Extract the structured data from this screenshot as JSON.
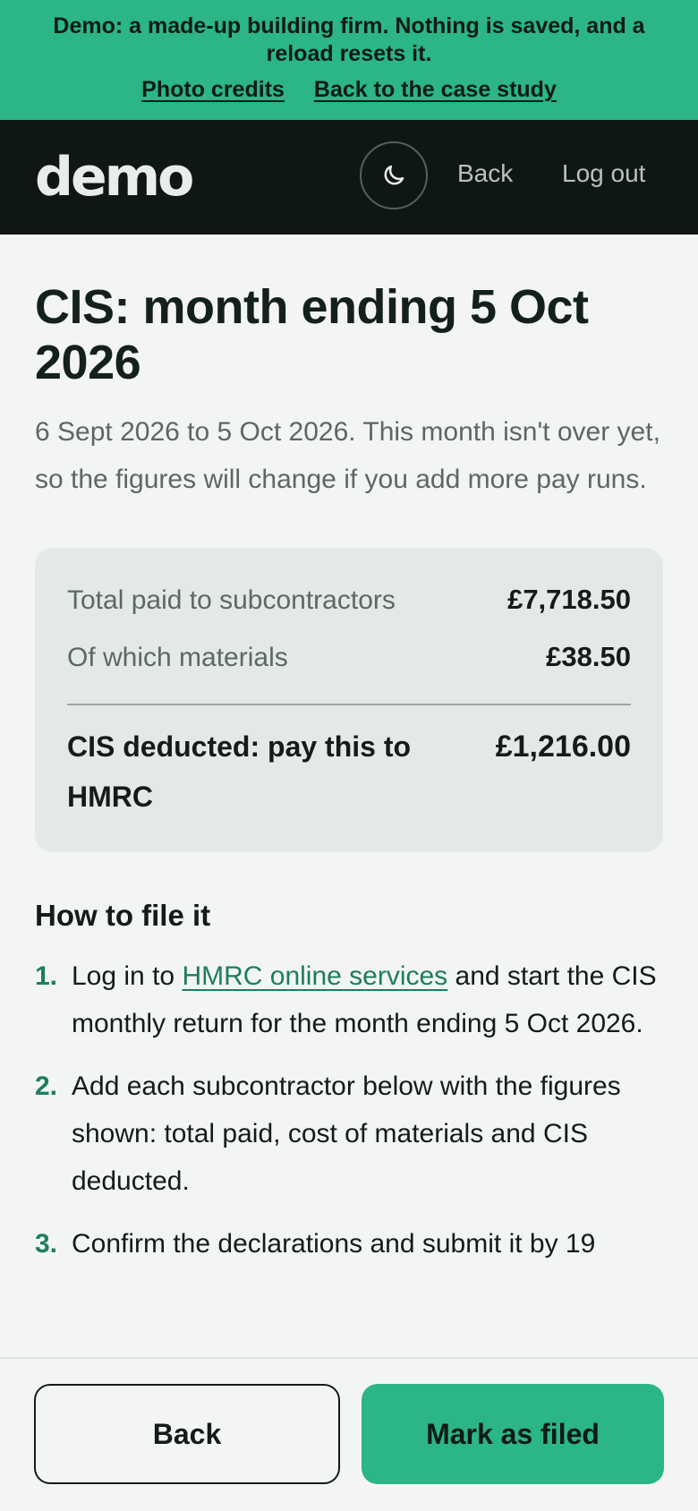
{
  "banner": {
    "text": "Demo: a made-up building firm. Nothing is saved, and a reload resets it.",
    "links": [
      "Photo credits",
      "Back to the case study"
    ]
  },
  "header": {
    "logo": "demo",
    "theme_icon": "moon-icon",
    "nav": {
      "back": "Back",
      "logout": "Log out"
    }
  },
  "page": {
    "title": "CIS: month ending 5 Oct 2026",
    "subtitle": "6 Sept 2026 to 5 Oct 2026. This month isn't over yet, so the figures will change if you add more pay runs."
  },
  "summary": {
    "rows": [
      {
        "label": "Total paid to subcontractors",
        "value": "£7,718.50"
      },
      {
        "label": "Of which materials",
        "value": "£38.50"
      }
    ],
    "total": {
      "label": "CIS deducted: pay this to HMRC",
      "value": "£1,216.00"
    }
  },
  "how_to": {
    "heading": "How to file it",
    "steps": [
      {
        "num": "1.",
        "before": "Log in to ",
        "link": "HMRC online services",
        "after": " and start the CIS monthly return for the month ending 5 Oct 2026."
      },
      {
        "num": "2.",
        "text": "Add each subcontractor below with the figures shown: total paid, cost of materials and CIS deducted."
      },
      {
        "num": "3.",
        "text": "Confirm the declarations and submit it by 19"
      }
    ]
  },
  "footer": {
    "back": "Back",
    "primary": "Mark as filed"
  },
  "colors": {
    "accent": "#2bb589",
    "dark": "#0f1714",
    "link": "#1e7d5f"
  }
}
